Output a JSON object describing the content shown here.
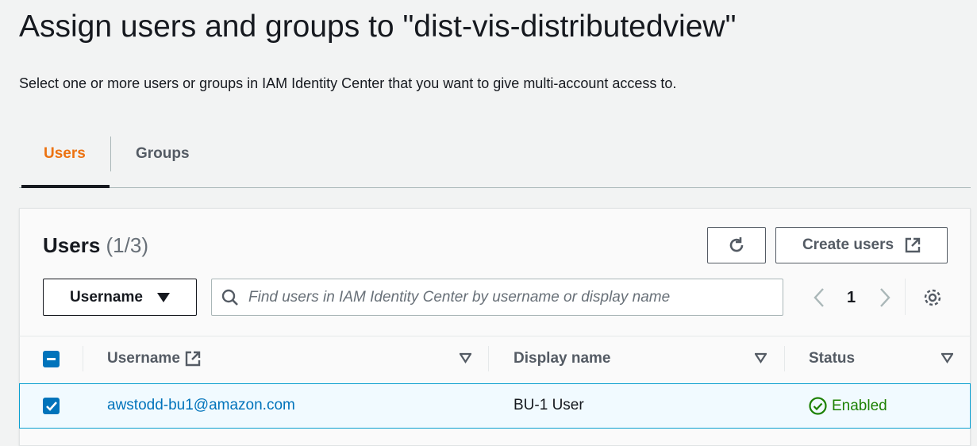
{
  "page": {
    "title": "Assign users and groups to \"dist-vis-distributedview\"",
    "description": "Select one or more users or groups in IAM Identity Center that you want to give multi-account access to."
  },
  "tabs": [
    {
      "label": "Users",
      "active": true
    },
    {
      "label": "Groups",
      "active": false
    }
  ],
  "panel": {
    "title": "Users",
    "count": "(1/3)",
    "create_label": "Create users",
    "filter_property": "Username",
    "search_placeholder": "Find users in IAM Identity Center by username or display name",
    "page": "1"
  },
  "table": {
    "columns": [
      "Username",
      "Display name",
      "Status"
    ],
    "rows": [
      {
        "username": "awstodd-bu1@amazon.com",
        "display_name": "BU-1 User",
        "status": "Enabled",
        "selected": true
      }
    ]
  },
  "colors": {
    "accent": "#ec7211",
    "link": "#0073bb",
    "success": "#1d8102"
  }
}
